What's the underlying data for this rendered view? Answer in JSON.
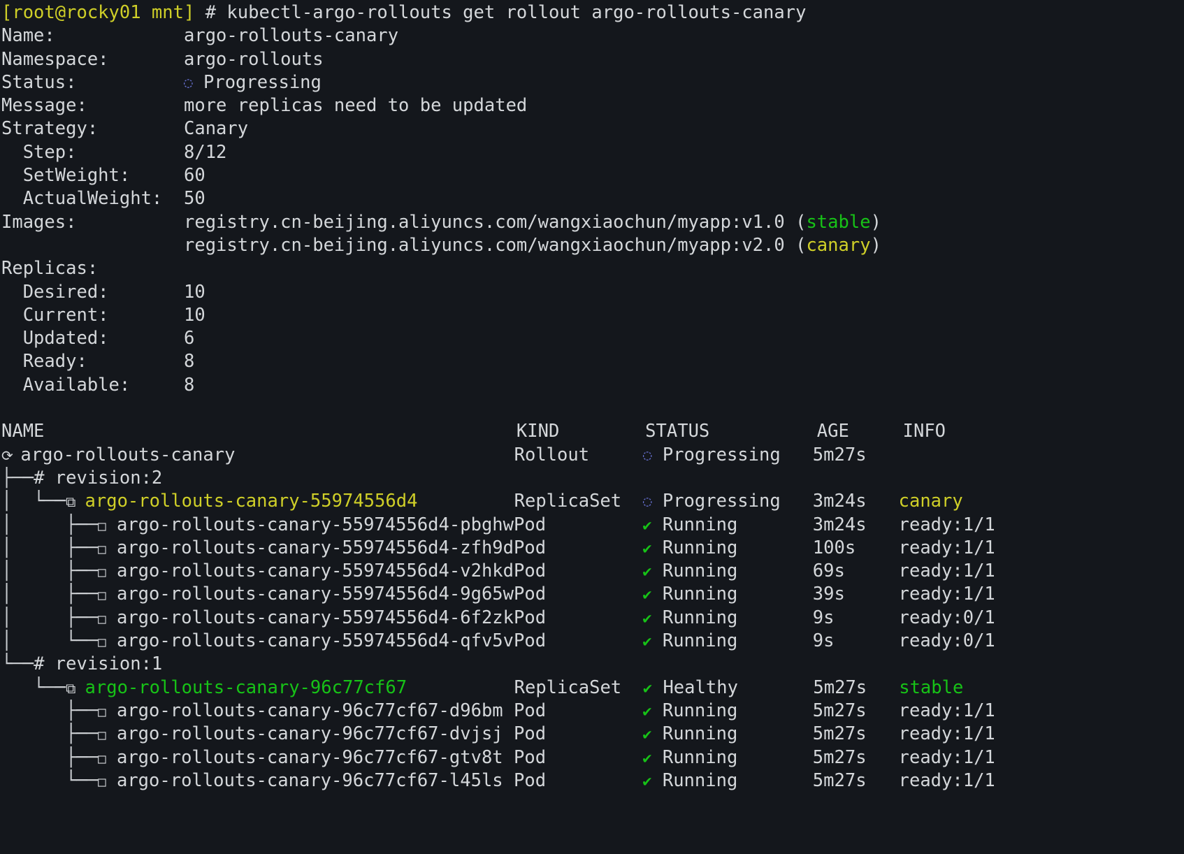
{
  "terminal": {
    "background": "#14171c",
    "foreground": "#d4d7da",
    "prompt_color": "#cfcf28",
    "green": "#17c217",
    "yellow": "#cfcf28",
    "progressing_icon_color": "#6a74d8"
  },
  "prompt": {
    "user_host": "[root@rocky01 mnt]",
    "sigil": "#",
    "command": "kubectl-argo-rollouts get rollout argo-rollouts-canary"
  },
  "summary": {
    "rows": [
      {
        "label": "Name:",
        "value": "argo-rollouts-canary"
      },
      {
        "label": "Namespace:",
        "value": "argo-rollouts"
      },
      {
        "label": "Status:",
        "value": "Progressing",
        "icon": "progressing-icon"
      },
      {
        "label": "Message:",
        "value": "more replicas need to be updated"
      },
      {
        "label": "Strategy:",
        "value": "Canary"
      },
      {
        "label": "  Step:",
        "value": "8/12"
      },
      {
        "label": "  SetWeight:",
        "value": "60"
      },
      {
        "label": "  ActualWeight:",
        "value": "50"
      }
    ],
    "images_label": "Images:",
    "images": [
      {
        "ref": "registry.cn-beijing.aliyuncs.com/wangxiaochun/myapp:v1.0",
        "tag": "stable",
        "tag_color": "#17c217"
      },
      {
        "ref": "registry.cn-beijing.aliyuncs.com/wangxiaochun/myapp:v2.0",
        "tag": "canary",
        "tag_color": "#cfcf28"
      }
    ],
    "replicas_label": "Replicas:",
    "replicas": [
      {
        "label": "  Desired:",
        "value": "10"
      },
      {
        "label": "  Current:",
        "value": "10"
      },
      {
        "label": "  Updated:",
        "value": "6"
      },
      {
        "label": "  Ready:",
        "value": "8"
      },
      {
        "label": "  Available:",
        "value": "8"
      }
    ]
  },
  "table": {
    "headers": {
      "name": "NAME",
      "kind": "KIND",
      "status": "STATUS",
      "age": "AGE",
      "info": "INFO"
    },
    "rows": [
      {
        "type": "rollout",
        "tree": "",
        "icon": "rollout-icon",
        "name": "argo-rollouts-canary",
        "name_color": "#d4d7da",
        "kind": "Rollout",
        "status_icon": "progressing-icon",
        "status": "Progressing",
        "age": "5m27s",
        "info": "",
        "info_color": "#d4d7da"
      },
      {
        "type": "revision",
        "tree": "├──",
        "icon": "hash-icon",
        "name": "revision:2",
        "name_color": "#d4d7da",
        "kind": "",
        "status_icon": "",
        "status": "",
        "age": "",
        "info": "",
        "info_color": "#d4d7da"
      },
      {
        "type": "replicaset",
        "tree": "│  └──",
        "icon": "replicaset-icon",
        "name": "argo-rollouts-canary-55974556d4",
        "name_color": "#cfcf28",
        "kind": "ReplicaSet",
        "status_icon": "progressing-icon",
        "status": "Progressing",
        "age": "3m24s",
        "info": "canary",
        "info_color": "#cfcf28"
      },
      {
        "type": "pod",
        "tree": "│     ├──",
        "icon": "pod-icon",
        "name": "argo-rollouts-canary-55974556d4-pbghw",
        "name_color": "#d4d7da",
        "kind": "Pod",
        "status_icon": "check-icon",
        "status": "Running",
        "age": "3m24s",
        "info": "ready:1/1",
        "info_color": "#d4d7da"
      },
      {
        "type": "pod",
        "tree": "│     ├──",
        "icon": "pod-icon",
        "name": "argo-rollouts-canary-55974556d4-zfh9d",
        "name_color": "#d4d7da",
        "kind": "Pod",
        "status_icon": "check-icon",
        "status": "Running",
        "age": "100s",
        "info": "ready:1/1",
        "info_color": "#d4d7da"
      },
      {
        "type": "pod",
        "tree": "│     ├──",
        "icon": "pod-icon",
        "name": "argo-rollouts-canary-55974556d4-v2hkd",
        "name_color": "#d4d7da",
        "kind": "Pod",
        "status_icon": "check-icon",
        "status": "Running",
        "age": "69s",
        "info": "ready:1/1",
        "info_color": "#d4d7da"
      },
      {
        "type": "pod",
        "tree": "│     ├──",
        "icon": "pod-icon",
        "name": "argo-rollouts-canary-55974556d4-9g65w",
        "name_color": "#d4d7da",
        "kind": "Pod",
        "status_icon": "check-icon",
        "status": "Running",
        "age": "39s",
        "info": "ready:1/1",
        "info_color": "#d4d7da"
      },
      {
        "type": "pod",
        "tree": "│     ├──",
        "icon": "pod-icon",
        "name": "argo-rollouts-canary-55974556d4-6f2zk",
        "name_color": "#d4d7da",
        "kind": "Pod",
        "status_icon": "check-icon",
        "status": "Running",
        "age": "9s",
        "info": "ready:0/1",
        "info_color": "#d4d7da"
      },
      {
        "type": "pod",
        "tree": "│     └──",
        "icon": "pod-icon",
        "name": "argo-rollouts-canary-55974556d4-qfv5v",
        "name_color": "#d4d7da",
        "kind": "Pod",
        "status_icon": "check-icon",
        "status": "Running",
        "age": "9s",
        "info": "ready:0/1",
        "info_color": "#d4d7da"
      },
      {
        "type": "revision",
        "tree": "└──",
        "icon": "hash-icon",
        "name": "revision:1",
        "name_color": "#d4d7da",
        "kind": "",
        "status_icon": "",
        "status": "",
        "age": "",
        "info": "",
        "info_color": "#d4d7da"
      },
      {
        "type": "replicaset",
        "tree": "   └──",
        "icon": "replicaset-icon",
        "name": "argo-rollouts-canary-96c77cf67",
        "name_color": "#17c217",
        "kind": "ReplicaSet",
        "status_icon": "check-icon",
        "status": "Healthy",
        "age": "5m27s",
        "info": "stable",
        "info_color": "#17c217"
      },
      {
        "type": "pod",
        "tree": "      ├──",
        "icon": "pod-icon",
        "name": "argo-rollouts-canary-96c77cf67-d96bm",
        "name_color": "#d4d7da",
        "kind": "Pod",
        "status_icon": "check-icon",
        "status": "Running",
        "age": "5m27s",
        "info": "ready:1/1",
        "info_color": "#d4d7da"
      },
      {
        "type": "pod",
        "tree": "      ├──",
        "icon": "pod-icon",
        "name": "argo-rollouts-canary-96c77cf67-dvjsj",
        "name_color": "#d4d7da",
        "kind": "Pod",
        "status_icon": "check-icon",
        "status": "Running",
        "age": "5m27s",
        "info": "ready:1/1",
        "info_color": "#d4d7da"
      },
      {
        "type": "pod",
        "tree": "      ├──",
        "icon": "pod-icon",
        "name": "argo-rollouts-canary-96c77cf67-gtv8t",
        "name_color": "#d4d7da",
        "kind": "Pod",
        "status_icon": "check-icon",
        "status": "Running",
        "age": "5m27s",
        "info": "ready:1/1",
        "info_color": "#d4d7da"
      },
      {
        "type": "pod",
        "tree": "      └──",
        "icon": "pod-icon",
        "name": "argo-rollouts-canary-96c77cf67-l45ls",
        "name_color": "#d4d7da",
        "kind": "Pod",
        "status_icon": "check-icon",
        "status": "Running",
        "age": "5m27s",
        "info": "ready:1/1",
        "info_color": "#d4d7da"
      }
    ]
  }
}
